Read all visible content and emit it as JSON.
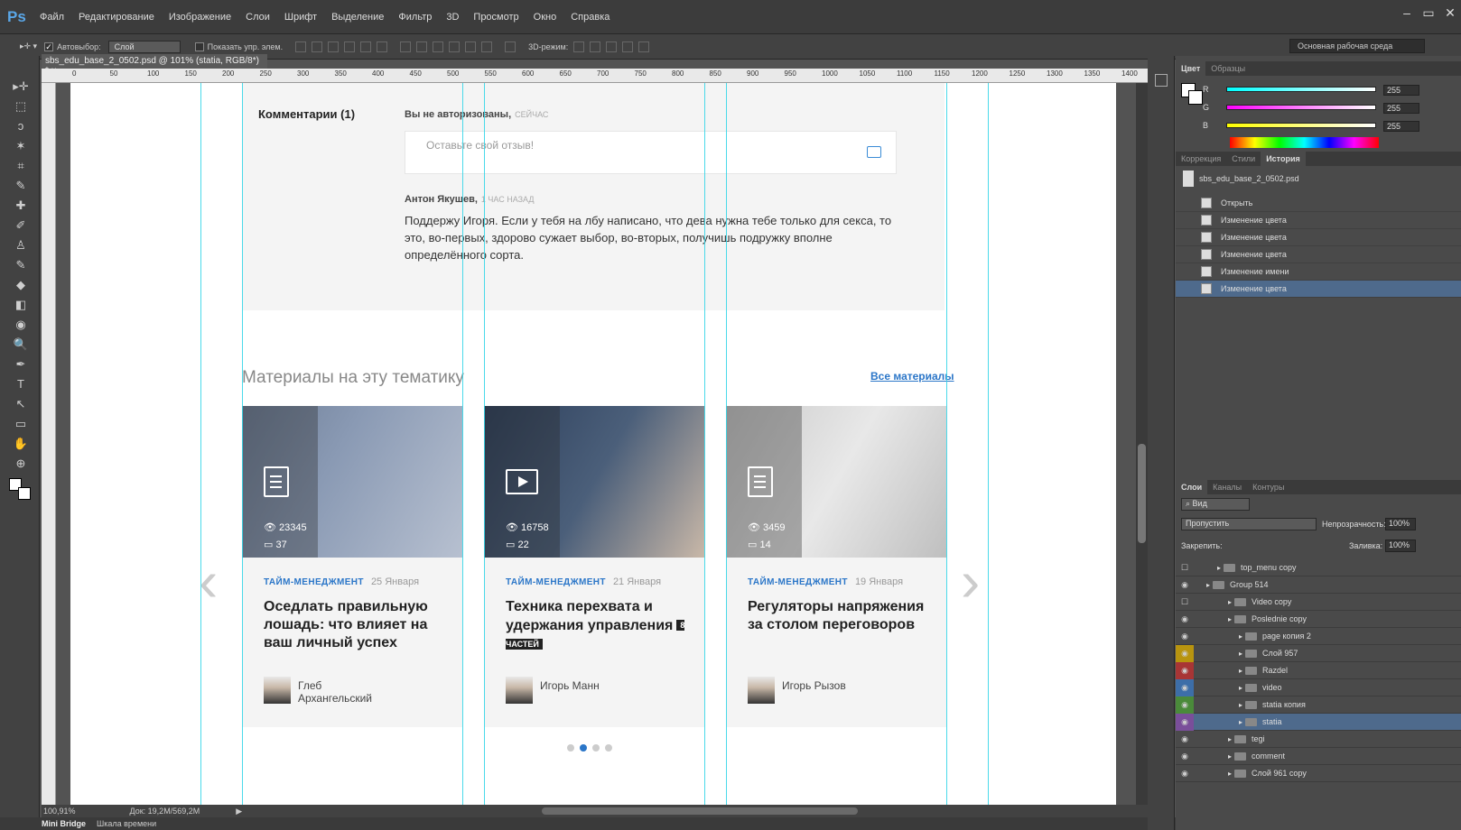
{
  "app": {
    "logo": "Ps",
    "menu": [
      "Файл",
      "Редактирование",
      "Изображение",
      "Слои",
      "Шрифт",
      "Выделение",
      "Фильтр",
      "3D",
      "Просмотр",
      "Окно",
      "Справка"
    ],
    "window_buttons": [
      "–",
      "▭",
      "✕"
    ]
  },
  "options": {
    "autoselect_label": "Автовыбор:",
    "autoselect_value": "Слой",
    "show_controls_label": "Показать упр. элем.",
    "mode3d_label": "3D-режим:",
    "workspace": "Основная рабочая среда"
  },
  "document": {
    "tab_title": "sbs_edu_base_2_0502.psd @ 101% (statia, RGB/8*) *",
    "close": "×",
    "zoom": "100,91%",
    "doc_size": "Док: 19,2M/569,2M"
  },
  "ruler_ticks": [
    "0",
    "50",
    "100",
    "150",
    "200",
    "250",
    "300",
    "350",
    "400",
    "450",
    "500",
    "550",
    "600",
    "650",
    "700",
    "750",
    "800",
    "850",
    "900",
    "950",
    "1000",
    "1050",
    "1100",
    "1150",
    "1200",
    "1250",
    "1300",
    "1350",
    "1400"
  ],
  "bottom_tabs": [
    "Mini Bridge",
    "Шкала времени"
  ],
  "tools": [
    "▸✛",
    "⬚",
    "ↄ",
    "✶",
    "⌗",
    "✎",
    "✚",
    "✐",
    "♙",
    "✎",
    "◆",
    "◧",
    "◉",
    "🔍",
    "✒",
    "T",
    "↖",
    "▭",
    "✋",
    "⊕"
  ],
  "page": {
    "comments": {
      "title": "Комментарии (1)",
      "not_authorized": "Вы не авторизованы,",
      "now": "СЕЙЧАС",
      "input_placeholder": "Оставьте свой отзыв!",
      "author": "Антон Якушев,",
      "author_ago": "1 ЧАС НАЗАД",
      "text": "Поддержу Игоря. Если у тебя на лбу написано, что дева нужна тебе только для секса, то это, во-первых, здорово сужает выбор, во-вторых, получишь подружку вполне определённого сорта."
    },
    "materials": {
      "title": "Материалы на эту тематику",
      "all_link": "Все материалы",
      "cards": [
        {
          "tag": "ТАЙМ-МЕНЕДЖМЕНТ",
          "date": "25 Января",
          "title": "Оседлать правильную лошадь: что влияет на ваш личный успех",
          "views": "23345",
          "comments": "37",
          "author": "Глеб Архангельский",
          "badge": ""
        },
        {
          "tag": "ТАЙМ-МЕНЕДЖМЕНТ",
          "date": "21 Января",
          "title": "Техника перехвата и удержания управления",
          "views": "16758",
          "comments": "22",
          "author": "Игорь Манн",
          "badge": "8 ЧАСТЕЙ"
        },
        {
          "tag": "ТАЙМ-МЕНЕДЖМЕНТ",
          "date": "19 Января",
          "title": "Регуляторы напряжения за столом переговоров",
          "views": "3459",
          "comments": "14",
          "author": "Игорь Рызов",
          "badge": ""
        }
      ]
    }
  },
  "panels": {
    "color_tabs": [
      "Цвет",
      "Образцы"
    ],
    "rgb": [
      {
        "label": "R",
        "value": "255"
      },
      {
        "label": "G",
        "value": "255"
      },
      {
        "label": "B",
        "value": "255"
      }
    ],
    "history_tabs": [
      "Коррекция",
      "Стили",
      "История"
    ],
    "history_file": "sbs_edu_base_2_0502.psd",
    "history_items": [
      "Открыть",
      "Изменение цвета",
      "Изменение цвета",
      "Изменение цвета",
      "Изменение имени",
      "Изменение цвета"
    ],
    "layers_tabs": [
      "Слои",
      "Каналы",
      "Контуры"
    ],
    "kind_label": "Вид",
    "blend_mode": "Пропустить",
    "opacity_label": "Непрозрачность:",
    "opacity_value": "100%",
    "lock_label": "Закрепить:",
    "fill_label": "Заливка:",
    "fill_value": "100%",
    "layers": [
      {
        "name": "top_menu copy",
        "indent": 1,
        "eye": false,
        "color": ""
      },
      {
        "name": "Group 514",
        "indent": 0,
        "eye": true,
        "color": ""
      },
      {
        "name": "Video copy",
        "indent": 2,
        "eye": false,
        "color": ""
      },
      {
        "name": "Poslednie copy",
        "indent": 2,
        "eye": true,
        "color": ""
      },
      {
        "name": "page копия 2",
        "indent": 3,
        "eye": true,
        "color": ""
      },
      {
        "name": "Слой 957",
        "indent": 3,
        "eye": true,
        "color": "#b8940f"
      },
      {
        "name": "Razdel",
        "indent": 3,
        "eye": true,
        "color": "#a83535"
      },
      {
        "name": "video",
        "indent": 3,
        "eye": true,
        "color": "#3d6ea8"
      },
      {
        "name": "statia копия",
        "indent": 3,
        "eye": true,
        "color": "#4a8a3a"
      },
      {
        "name": "statia",
        "indent": 3,
        "eye": true,
        "color": "#7a4e9a"
      },
      {
        "name": "tegi",
        "indent": 2,
        "eye": true,
        "color": ""
      },
      {
        "name": "comment",
        "indent": 2,
        "eye": true,
        "color": ""
      },
      {
        "name": "Слой 961 copy",
        "indent": 2,
        "eye": true,
        "color": ""
      }
    ]
  }
}
